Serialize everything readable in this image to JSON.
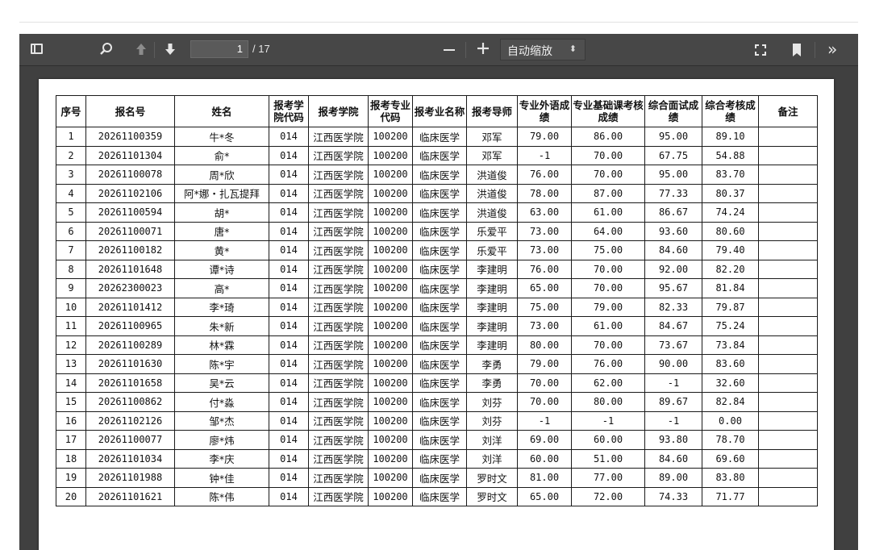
{
  "toolbar": {
    "page_current": "1",
    "page_total": "/ 17",
    "zoom_label": "自动缩放",
    "zoom_arrow": "⬍",
    "more_label": "»"
  },
  "table": {
    "headers": [
      "序号",
      "报名号",
      "姓名",
      "报考学院代码",
      "报考学院",
      "报考专业代码",
      "报考业名称",
      "报考导师",
      "专业外语成绩",
      "专业基础课考核成绩",
      "综合面试成绩",
      "综合考核成绩",
      "备注"
    ],
    "rows": [
      [
        "1",
        "20261100359",
        "牛*冬",
        "014",
        "江西医学院",
        "100200",
        "临床医学",
        "邓军",
        "79.00",
        "86.00",
        "95.00",
        "89.10",
        ""
      ],
      [
        "2",
        "20261101304",
        "俞*",
        "014",
        "江西医学院",
        "100200",
        "临床医学",
        "邓军",
        "-1",
        "70.00",
        "67.75",
        "54.88",
        ""
      ],
      [
        "3",
        "20261100078",
        "周*欣",
        "014",
        "江西医学院",
        "100200",
        "临床医学",
        "洪道俊",
        "76.00",
        "70.00",
        "95.00",
        "83.70",
        ""
      ],
      [
        "4",
        "20261102106",
        "阿*娜・扎瓦提拜",
        "014",
        "江西医学院",
        "100200",
        "临床医学",
        "洪道俊",
        "78.00",
        "87.00",
        "77.33",
        "80.37",
        ""
      ],
      [
        "5",
        "20261100594",
        "胡*",
        "014",
        "江西医学院",
        "100200",
        "临床医学",
        "洪道俊",
        "63.00",
        "61.00",
        "86.67",
        "74.24",
        ""
      ],
      [
        "6",
        "20261100071",
        "唐*",
        "014",
        "江西医学院",
        "100200",
        "临床医学",
        "乐爱平",
        "73.00",
        "64.00",
        "93.60",
        "80.60",
        ""
      ],
      [
        "7",
        "20261100182",
        "黄*",
        "014",
        "江西医学院",
        "100200",
        "临床医学",
        "乐爱平",
        "73.00",
        "75.00",
        "84.60",
        "79.40",
        ""
      ],
      [
        "8",
        "20261101648",
        "谭*诗",
        "014",
        "江西医学院",
        "100200",
        "临床医学",
        "李建明",
        "76.00",
        "70.00",
        "92.00",
        "82.20",
        ""
      ],
      [
        "9",
        "20262300023",
        "高*",
        "014",
        "江西医学院",
        "100200",
        "临床医学",
        "李建明",
        "65.00",
        "70.00",
        "95.67",
        "81.84",
        ""
      ],
      [
        "10",
        "20261101412",
        "李*琦",
        "014",
        "江西医学院",
        "100200",
        "临床医学",
        "李建明",
        "75.00",
        "79.00",
        "82.33",
        "79.87",
        ""
      ],
      [
        "11",
        "20261100965",
        "朱*新",
        "014",
        "江西医学院",
        "100200",
        "临床医学",
        "李建明",
        "73.00",
        "61.00",
        "84.67",
        "75.24",
        ""
      ],
      [
        "12",
        "20261100289",
        "林*霖",
        "014",
        "江西医学院",
        "100200",
        "临床医学",
        "李建明",
        "80.00",
        "70.00",
        "73.67",
        "73.84",
        ""
      ],
      [
        "13",
        "20261101630",
        "陈*宇",
        "014",
        "江西医学院",
        "100200",
        "临床医学",
        "李勇",
        "79.00",
        "76.00",
        "90.00",
        "83.60",
        ""
      ],
      [
        "14",
        "20261101658",
        "吴*云",
        "014",
        "江西医学院",
        "100200",
        "临床医学",
        "李勇",
        "70.00",
        "62.00",
        "-1",
        "32.60",
        ""
      ],
      [
        "15",
        "20261100862",
        "付*淼",
        "014",
        "江西医学院",
        "100200",
        "临床医学",
        "刘芬",
        "70.00",
        "80.00",
        "89.67",
        "82.84",
        ""
      ],
      [
        "16",
        "20261102126",
        "邹*杰",
        "014",
        "江西医学院",
        "100200",
        "临床医学",
        "刘芬",
        "-1",
        "-1",
        "-1",
        "0.00",
        ""
      ],
      [
        "17",
        "20261100077",
        "廖*炜",
        "014",
        "江西医学院",
        "100200",
        "临床医学",
        "刘洋",
        "69.00",
        "60.00",
        "93.80",
        "78.70",
        ""
      ],
      [
        "18",
        "20261101034",
        "李*庆",
        "014",
        "江西医学院",
        "100200",
        "临床医学",
        "刘洋",
        "60.00",
        "51.00",
        "84.60",
        "69.60",
        ""
      ],
      [
        "19",
        "20261101988",
        "钟*佳",
        "014",
        "江西医学院",
        "100200",
        "临床医学",
        "罗时文",
        "81.00",
        "77.00",
        "89.00",
        "83.80",
        ""
      ],
      [
        "20",
        "20261101621",
        "陈*伟",
        "014",
        "江西医学院",
        "100200",
        "临床医学",
        "罗时文",
        "65.00",
        "72.00",
        "74.33",
        "71.77",
        ""
      ]
    ]
  }
}
